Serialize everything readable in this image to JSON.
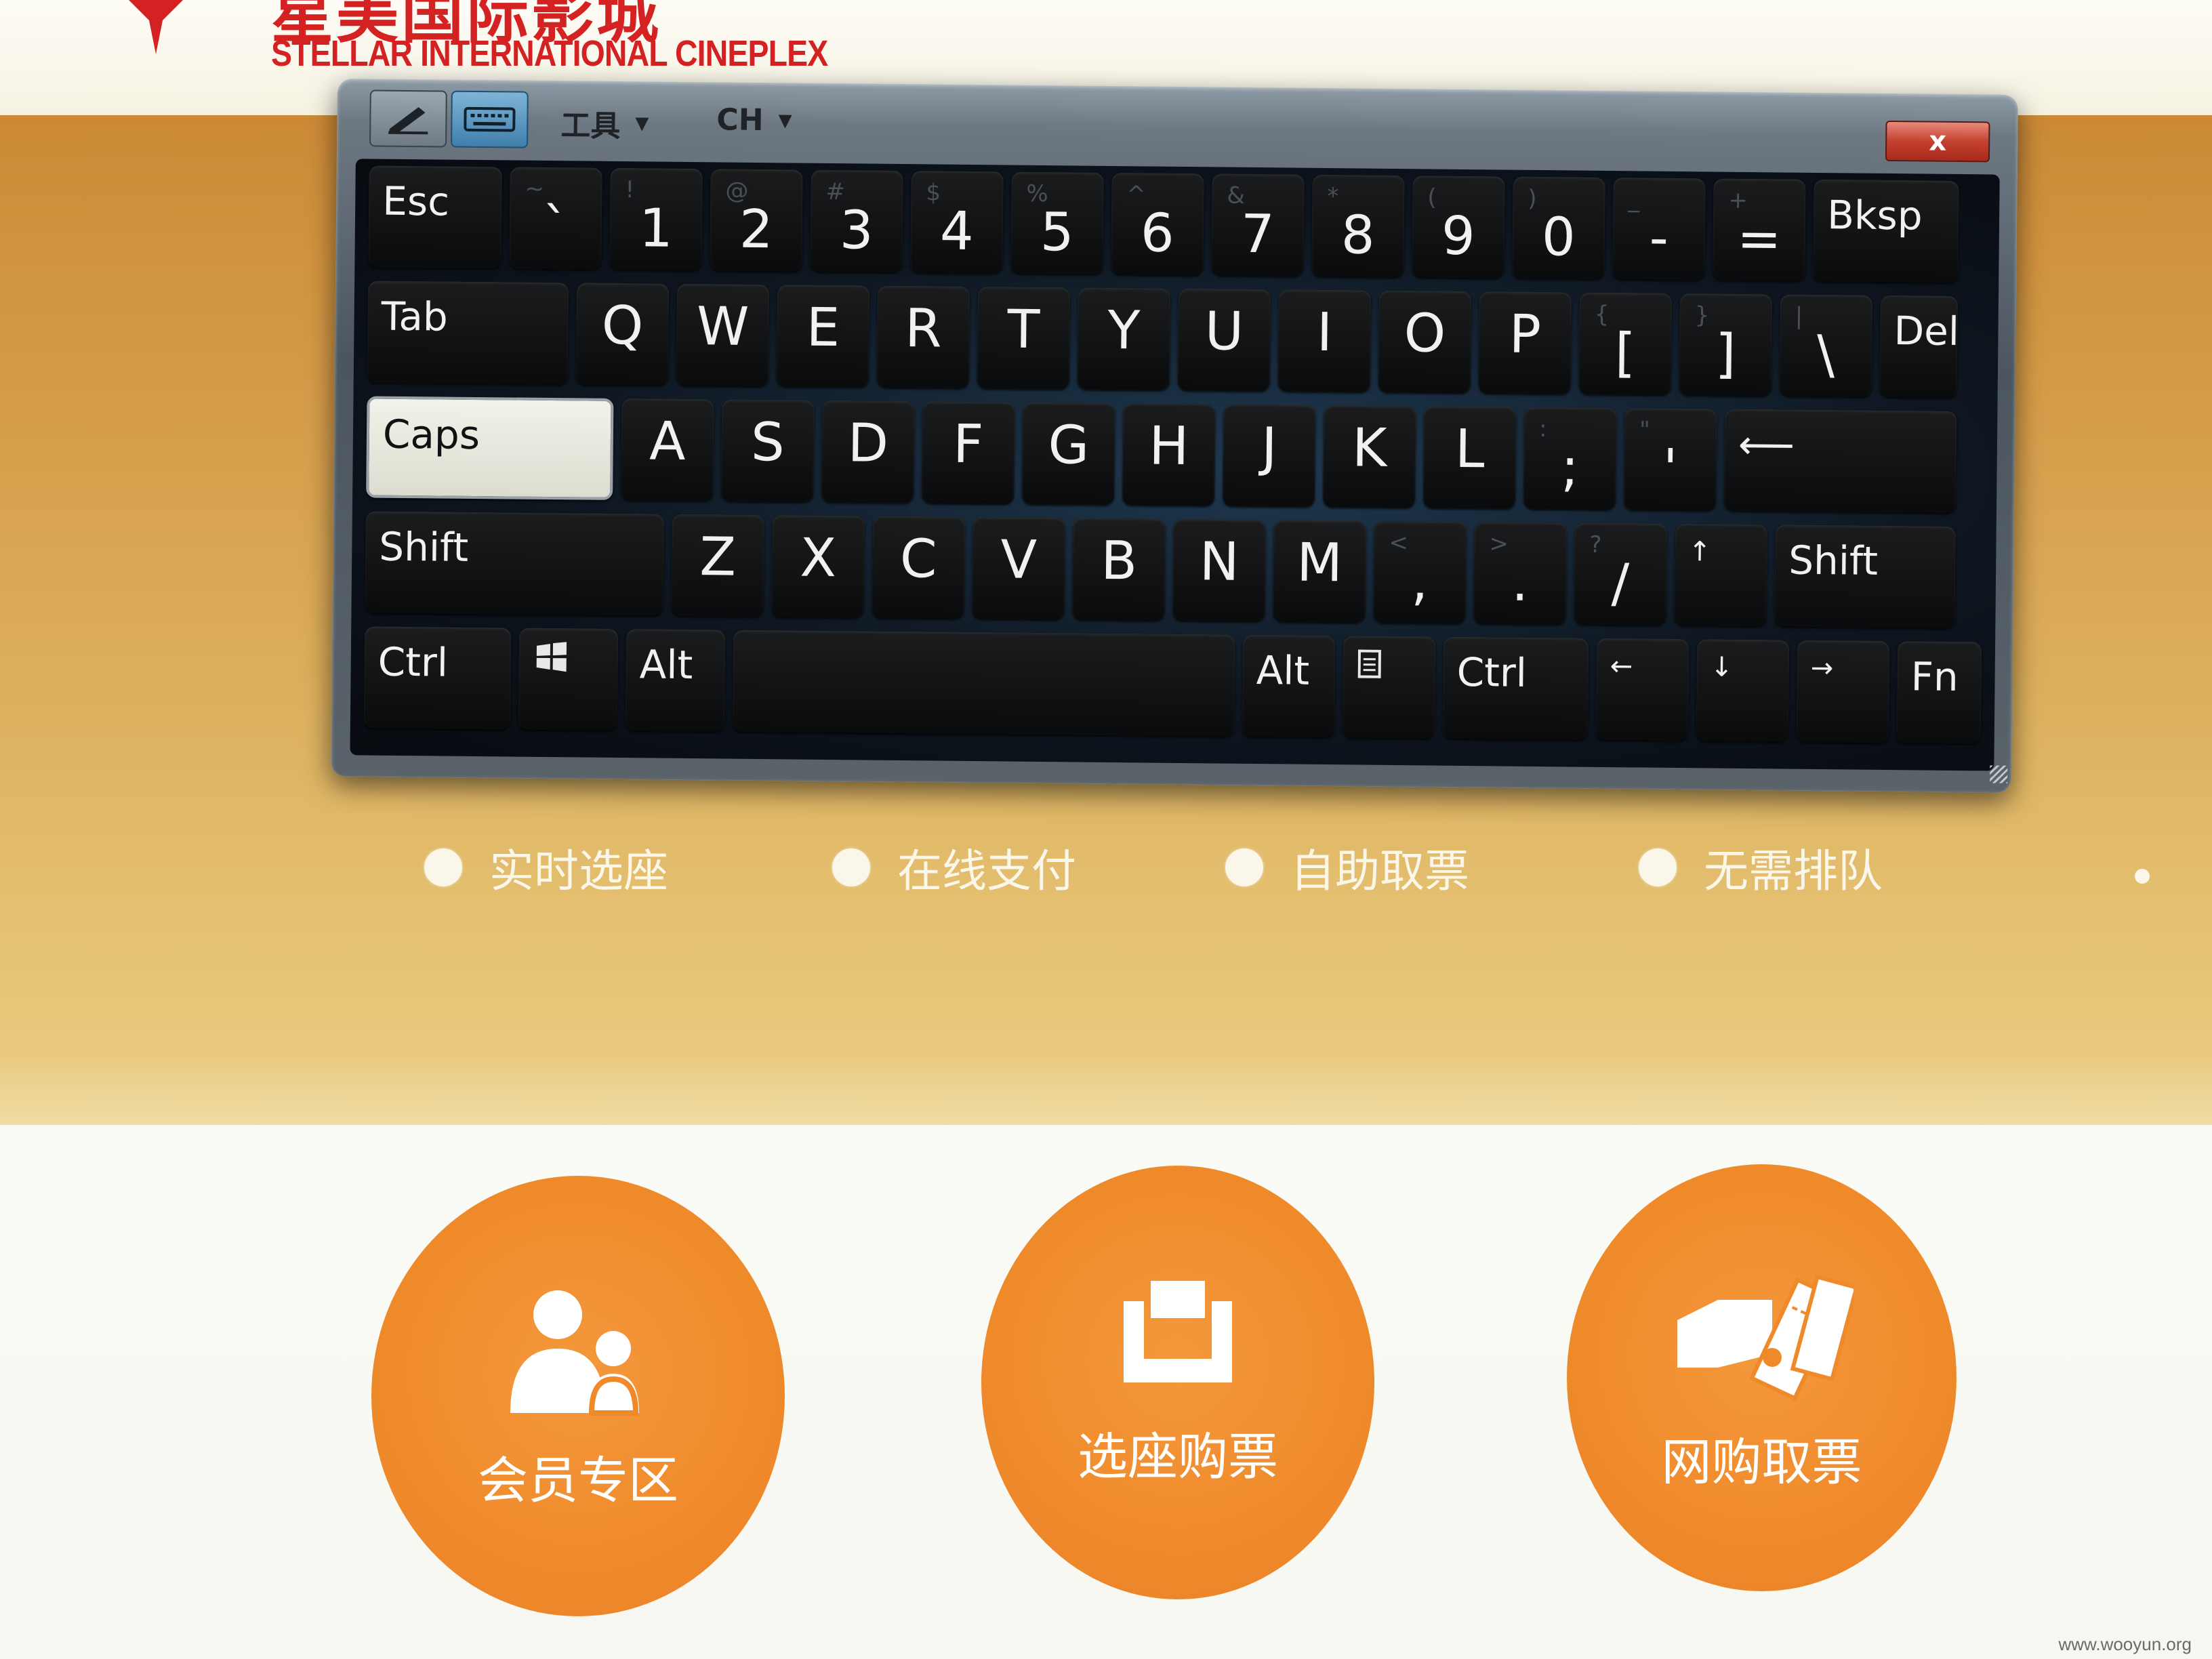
{
  "header": {
    "brand_cn": "星美国际影城",
    "brand_en": "STELLAR INTERNATIONAL CINEPLEX"
  },
  "keyboard": {
    "titlebar": {
      "tools_label": "工具",
      "lang_label": "CH",
      "close_label": "x",
      "icons": [
        "pen-icon",
        "keyboard-icon"
      ]
    },
    "keys": {
      "esc": "Esc",
      "bksp": "Bksp",
      "tab": "Tab",
      "del": "Del",
      "caps": "Caps",
      "shift": "Shift",
      "ctrl": "Ctrl",
      "alt": "Alt",
      "fn": "Fn",
      "row1": [
        {
          "main": "`",
          "shift": "~"
        },
        {
          "main": "1",
          "shift": "!"
        },
        {
          "main": "2",
          "shift": "@"
        },
        {
          "main": "3",
          "shift": "#"
        },
        {
          "main": "4",
          "shift": "$"
        },
        {
          "main": "5",
          "shift": "%"
        },
        {
          "main": "6",
          "shift": "^"
        },
        {
          "main": "7",
          "shift": "&"
        },
        {
          "main": "8",
          "shift": "*"
        },
        {
          "main": "9",
          "shift": "("
        },
        {
          "main": "0",
          "shift": ")"
        },
        {
          "main": "-",
          "shift": "_"
        },
        {
          "main": "=",
          "shift": "+"
        }
      ],
      "row2": [
        "Q",
        "W",
        "E",
        "R",
        "T",
        "Y",
        "U",
        "I",
        "O",
        "P"
      ],
      "row2_sym": [
        {
          "main": "[",
          "shift": "{"
        },
        {
          "main": "]",
          "shift": "}"
        },
        {
          "main": "\\",
          "shift": "|"
        }
      ],
      "row3": [
        "A",
        "S",
        "D",
        "F",
        "G",
        "H",
        "J",
        "K",
        "L"
      ],
      "row3_sym": [
        {
          "main": ";",
          "shift": ":"
        },
        {
          "main": "'",
          "shift": "\""
        }
      ],
      "enter": "⟵",
      "row4": [
        "Z",
        "X",
        "C",
        "V",
        "B",
        "N",
        "M"
      ],
      "row4_sym": [
        {
          "main": ",",
          "shift": "<"
        },
        {
          "main": ".",
          "shift": ">"
        },
        {
          "main": "/",
          "shift": "?"
        }
      ],
      "up": "↑",
      "left": "←",
      "down": "↓",
      "right": "→",
      "caps_state": "active"
    }
  },
  "features": [
    "实时选座",
    "在线支付",
    "自助取票",
    "无需排队"
  ],
  "buttons": [
    {
      "label": "会员专区",
      "icon": "members-icon"
    },
    {
      "label": "选座购票",
      "icon": "seat-icon"
    },
    {
      "label": "网购取票",
      "icon": "ticket-icon"
    }
  ],
  "watermark": "www.wooyun.org",
  "colors": {
    "brand_red": "#d42222",
    "banner_gold": "#d49a47",
    "button_orange": "#ef8a2b"
  }
}
